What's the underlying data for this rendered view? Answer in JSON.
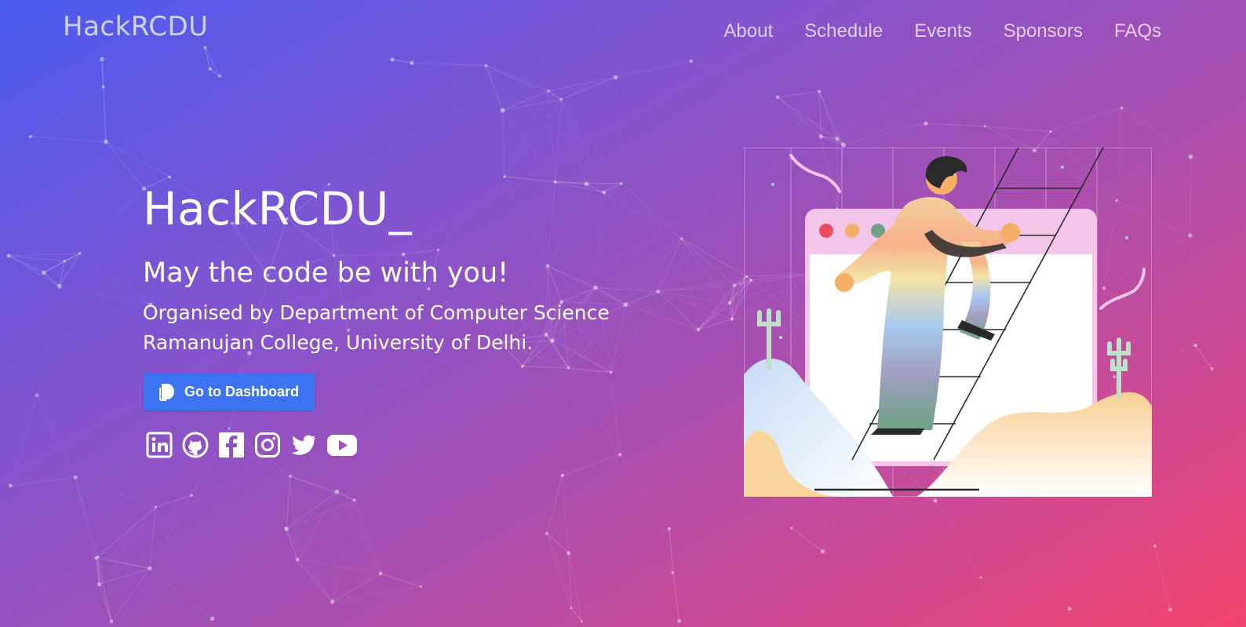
{
  "brand": "HackRCDU",
  "nav": [
    "About",
    "Schedule",
    "Events",
    "Sponsors",
    "FAQs"
  ],
  "hero": {
    "title": "HackRCDU_",
    "tagline": "May the code be with you!",
    "org_line1": "Organised by Department of Computer Science",
    "org_line2": "Ramanujan College, University of Delhi.",
    "dashboard_button": "Go to Dashboard"
  },
  "social_icons": [
    "linkedin-icon",
    "github-icon",
    "facebook-icon",
    "instagram-icon",
    "twitter-icon",
    "youtube-icon"
  ],
  "colors": {
    "gradient_start": "#4a5cf0",
    "gradient_end": "#f4436c",
    "button": "#3c73f3"
  }
}
